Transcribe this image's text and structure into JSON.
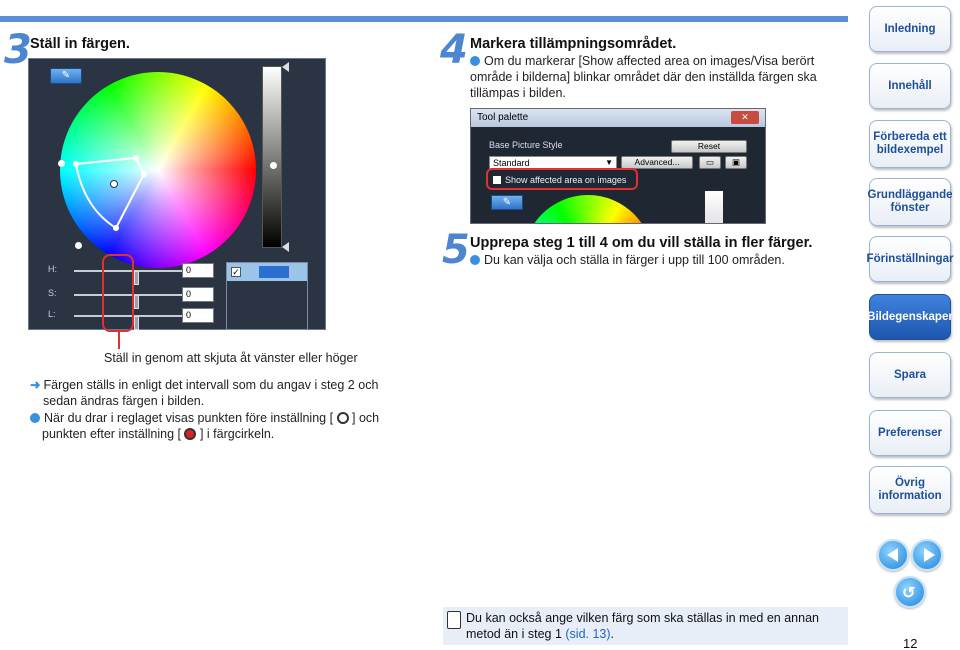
{
  "step3": {
    "number": "3",
    "title": "Ställ in färgen."
  },
  "step4": {
    "number": "4",
    "title": "Markera tillämpningsområdet.",
    "bullet": "Om du markerar [Show affected area on images/Visa berört område i bilderna] blinkar området där den inställda färgen ska tillämpas i bilden."
  },
  "step5": {
    "number": "5",
    "title": "Upprepa steg 1 till 4 om du vill ställa in fler färger.",
    "bullet": "Du kan välja och ställa in färger i upp till 100 områden."
  },
  "color_panel": {
    "sliders": [
      {
        "label": "H:",
        "value": "0",
        "level": 0.5
      },
      {
        "label": "S:",
        "value": "0",
        "level": 0.5
      },
      {
        "label": "L:",
        "value": "0",
        "level": 0.5
      }
    ],
    "caption": "Ställ in genom att skjuta åt vänster eller höger"
  },
  "tool_palette": {
    "title": "Tool palette",
    "close": "✕",
    "style_label": "Base Picture Style",
    "reset": "Reset",
    "style_value": "Standard",
    "advanced": "Advanced...",
    "show_area": "Show affected area on images"
  },
  "notes": {
    "result_line1": "Färgen ställs in enligt det intervall som du angav i steg 2 och",
    "result_line2": "sedan ändras färgen i bilden.",
    "drag_a": "När du drar i reglaget visas punkten före inställning [",
    "drag_b": "] och",
    "drag_c": "punkten efter inställning [",
    "drag_d": "] i färgcirkeln."
  },
  "tip": {
    "text": "Du kan också ange vilken färg som ska ställas in med en annan metod än i steg 1 ",
    "link": "(sid. 13)",
    "end": "."
  },
  "nav": [
    {
      "label": "Inledning",
      "active": false
    },
    {
      "label": "Innehåll",
      "active": false
    },
    {
      "label": "Förbereda ett bildexempel",
      "active": false
    },
    {
      "label": "Grundläggande fönster",
      "active": false
    },
    {
      "label": "Förinställningar",
      "active": false
    },
    {
      "label": "Bildegenskaper",
      "active": true
    },
    {
      "label": "Spara",
      "active": false
    },
    {
      "label": "Preferenser",
      "active": false
    },
    {
      "label": "Övrig information",
      "active": false
    }
  ],
  "page_number": "12",
  "colors": {
    "accent": "#4d86d0",
    "highlight": "#e03030",
    "nav_active": "#1d56ad"
  }
}
